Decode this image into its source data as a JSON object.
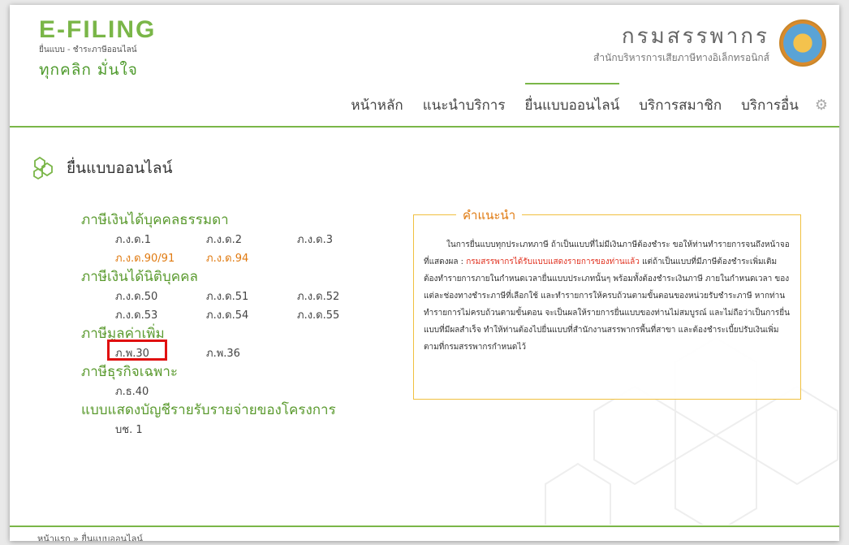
{
  "header": {
    "logo_title": "E-FILING",
    "logo_sub": "ยื่นแบบ - ชำระภาษีออนไลน์",
    "slogan": "ทุกคลิก มั่นใจ",
    "org_name": "กรมสรรพากร",
    "org_sub": "สำนักบริหารการเสียภาษีทางอิเล็กทรอนิกส์"
  },
  "nav": {
    "items": [
      "หน้าหลัก",
      "แนะนำบริการ",
      "ยื่นแบบออนไลน์",
      "บริการสมาชิก",
      "บริการอื่น"
    ],
    "active_index": 2
  },
  "page_title": "ยื่นแบบออนไลน์",
  "categories": [
    {
      "name": "ภาษีเงินได้บุคคลธรรมดา",
      "rows": [
        [
          "ภ.ง.ด.1",
          "ภ.ง.ด.2",
          "ภ.ง.ด.3"
        ],
        [
          "ภ.ง.ด.90/91",
          "ภ.ง.ด.94"
        ]
      ]
    },
    {
      "name": "ภาษีเงินได้นิติบุคคล",
      "rows": [
        [
          "ภ.ง.ด.50",
          "ภ.ง.ด.51",
          "ภ.ง.ด.52"
        ],
        [
          "ภ.ง.ด.53",
          "ภ.ง.ด.54",
          "ภ.ง.ด.55"
        ]
      ]
    },
    {
      "name": "ภาษีมูลค่าเพิ่ม",
      "rows": [
        [
          "ภ.พ.30",
          "ภ.พ.36"
        ]
      ]
    },
    {
      "name": "ภาษีธุรกิจเฉพาะ",
      "rows": [
        [
          "ภ.ธ.40"
        ]
      ]
    },
    {
      "name": "แบบแสดงบัญชีรายรับรายจ่ายของโครงการ",
      "rows": [
        [
          "บช. 1"
        ]
      ]
    }
  ],
  "highlighted_form": "ภ.พ.30",
  "advice": {
    "title": "คำแนะนำ",
    "text_before": "ในการยื่นแบบทุกประเภทภาษี ถ้าเป็นแบบที่ไม่มีเงินภาษีต้องชำระ ขอให้ท่านทำรายการจนถึงหน้าจอที่แสดงผล : ",
    "text_red": "กรมสรรพากรได้รับแบบแสดงรายการของท่านแล้ว",
    "text_after": " แต่ถ้าเป็นแบบที่มีภาษีต้องชำระเพิ่มเติม ต้องทำรายการภายในกำหนดเวลายื่นแบบประเภทนั้นๆ พร้อมทั้งต้องชำระเงินภาษี ภายในกำหนดเวลา ของแต่ละช่องทางชำระภาษีที่เลือกใช้ และทำรายการให้ครบถ้วนตามขั้นตอนของหน่วยรับชำระภาษี หากท่านทำรายการไม่ครบถ้วนตามขั้นตอน จะเป็นผลให้รายการยื่นแบบของท่านไม่สมบูรณ์ และไม่ถือว่าเป็นการยื่นแบบที่มีผลสำเร็จ ทำให้ท่านต้องไปยื่นแบบที่สำนักงานสรรพากรพื้นที่สาขา และต้องชำระเบี้ยปรับเงินเพิ่ม ตามที่กรมสรรพากรกำหนดไว้"
  },
  "breadcrumb": "หน้าแรก » ยื่นแบบออนไลน์",
  "colors": {
    "brand_green": "#7ab648",
    "orange": "#e07a10",
    "highlight_red": "#e01010"
  },
  "icons": {
    "settings": "gear-icon",
    "title": "hexagon-icon"
  }
}
